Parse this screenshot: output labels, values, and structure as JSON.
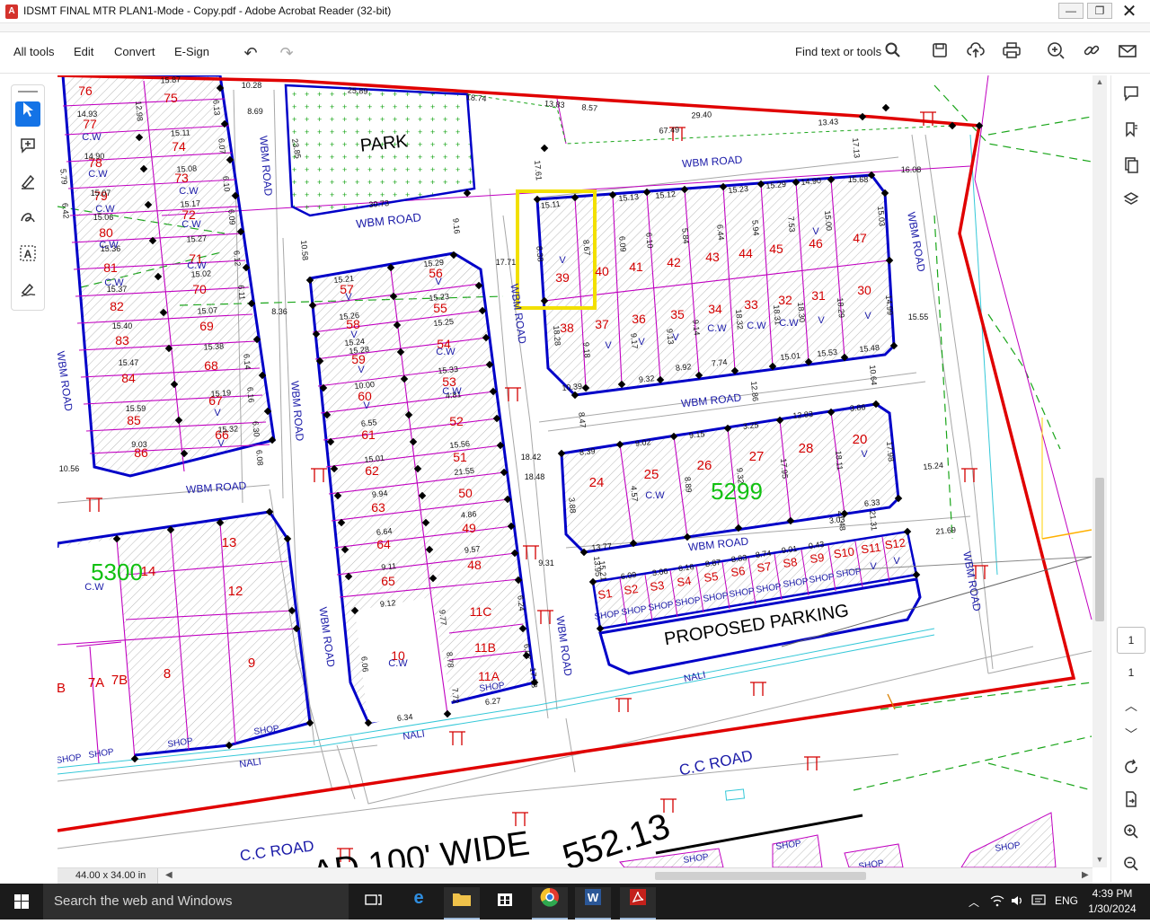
{
  "window": {
    "app_icon": "acrobat-icon",
    "title": "IDSMT FINAL MTR PLAN1-Mode - Copy.pdf - Adobe Acrobat Reader (32-bit)",
    "minimize": "—",
    "maximize": "❐",
    "close": "✕"
  },
  "toolbar": {
    "menus": [
      "All tools",
      "Edit",
      "Convert",
      "E-Sign"
    ],
    "undo": "↶",
    "redo": "↷",
    "find_label": "Find text or tools",
    "icons": [
      "search-icon",
      "save-icon",
      "upload-icon",
      "print-icon",
      "share-link-icon",
      "link-icon",
      "email-icon"
    ]
  },
  "left_tools": [
    "select-arrow-icon",
    "add-comment-icon",
    "highlight-pen-icon",
    "draw-freehand-icon",
    "text-select-icon",
    "fill-sign-icon"
  ],
  "right_rail": {
    "icons": [
      "comments-icon",
      "bookmarks-icon",
      "pages-icon",
      "layers-icon",
      "refresh-icon",
      "export-icon",
      "zoom-in-icon",
      "zoom-out-icon"
    ],
    "current_page": "1",
    "total_pages": "1"
  },
  "status": {
    "page_size": "44.00 x 34.00 in"
  },
  "taskbar": {
    "search_placeholder": "Search the web and Windows",
    "language": "ENG",
    "time": "4:39 PM",
    "date": "1/30/2024",
    "apps": [
      "task-view-icon",
      "edge-icon",
      "file-explorer-icon",
      "store-icon",
      "chrome-icon",
      "word-icon",
      "acrobat-icon"
    ]
  },
  "plan": {
    "colors": {
      "boundary": "#e00000",
      "block": "#0000c8",
      "plot_text": "#d40000",
      "highlight": "#f2e000",
      "number": "#10c010",
      "survey": "#00aa00"
    },
    "park_label": "PARK",
    "parking_label": "PROPOSED PARKING",
    "road_labels": {
      "wbm": "WBM ROAD",
      "cc_road": "C.C ROAD",
      "nali": "NALI",
      "wide": "AD 100' WIDE",
      "big_dim": "552.13"
    },
    "survey_numbers": [
      "5299",
      "5300"
    ],
    "tag_labels": {
      "cw": "C.W",
      "v": "V",
      "shop": "SHOP"
    },
    "block_a_plots": [
      "76",
      "75",
      "77",
      "74",
      "78",
      "73",
      "79",
      "72",
      "80",
      "71",
      "81",
      "70",
      "82",
      "69",
      "83",
      "68",
      "84",
      "67",
      "85",
      "66",
      "86"
    ],
    "block_b_plots": [
      "57",
      "56",
      "58",
      "55",
      "59",
      "54",
      "60",
      "53",
      "61",
      "52",
      "62",
      "51",
      "63",
      "50",
      "64",
      "49",
      "65",
      "48",
      "10",
      "11C",
      "11B",
      "11A"
    ],
    "block_c_plots_top": [
      "39",
      "40",
      "41",
      "42",
      "43",
      "44",
      "45",
      "46",
      "47"
    ],
    "block_c_plots_bottom": [
      "38",
      "37",
      "36",
      "35",
      "34",
      "33",
      "32",
      "31",
      "30"
    ],
    "block_d_plots": [
      "24",
      "25",
      "26",
      "27",
      "28",
      "20"
    ],
    "block_e_plots": [
      "13",
      "12",
      "8",
      "9",
      "7A",
      "7B",
      "B",
      "14"
    ],
    "shops": [
      "S1",
      "S2",
      "S3",
      "S4",
      "S5",
      "S6",
      "S7",
      "S8",
      "S9",
      "S10",
      "S11",
      "S12"
    ],
    "dims": [
      "15.87",
      "14.93",
      "12.98",
      "15.11",
      "14.90",
      "15.08",
      "15.07",
      "15.17",
      "15.06",
      "15.27",
      "15.36",
      "15.02",
      "15.37",
      "15.07",
      "15.40",
      "15.38",
      "15.47",
      "15.19",
      "15.59",
      "15.32",
      "9.03",
      "10.56",
      "10.28",
      "8.69",
      "6.13",
      "6.07",
      "6.10",
      "6.09",
      "6.12",
      "6.11",
      "6.14",
      "6.16",
      "6.30",
      "6.08",
      "5.79",
      "6.42",
      "25.89",
      "18.74",
      "13.83",
      "8.57",
      "29.40",
      "67.49",
      "13.43",
      "23.85",
      "30.73",
      "9.16",
      "10.58",
      "8.36",
      "15.21",
      "15.29",
      "15.26",
      "15.23",
      "15.24",
      "15.25",
      "15.28",
      "15.33",
      "10.00",
      "4.81",
      "6.55",
      "15.56",
      "15.01",
      "21.55",
      "9.94",
      "4.86",
      "6.64",
      "9.57",
      "9.11",
      "9.12",
      "9.77",
      "8.78",
      "7.72",
      "6.27",
      "6.34",
      "6.06",
      "6.24",
      "6.07",
      "17.78",
      "17.71",
      "17.61",
      "17.13",
      "16.08",
      "15.68",
      "15.11",
      "15.13",
      "15.12",
      "15.23",
      "15.29",
      "14.90",
      "8.38",
      "8.67",
      "6.09",
      "6.10",
      "5.84",
      "6.44",
      "5.94",
      "7.53",
      "15.00",
      "15.03",
      "14.99",
      "15.55",
      "15.48",
      "15.53",
      "15.01",
      "7.74",
      "8.92",
      "9.32",
      "10.39",
      "9.18",
      "9.17",
      "9.13",
      "9.14",
      "18.32",
      "18.31",
      "18.30",
      "18.29",
      "18.28",
      "10.64",
      "12.86",
      "8.47",
      "8.39",
      "9.02",
      "9.15",
      "3.25",
      "12.83",
      "3.86",
      "3.88",
      "4.57",
      "8.89",
      "9.32",
      "17.95",
      "18.11",
      "17.98",
      "13.77",
      "15.24",
      "18.42",
      "18.48",
      "9.31",
      "6.33",
      "3.03",
      "21.48",
      "21.31",
      "21.69",
      "13.95",
      "15.21",
      "6.09",
      "3.06",
      "6.16",
      "8.87",
      "8.83",
      "8.74",
      "9.01",
      "0.43"
    ]
  }
}
